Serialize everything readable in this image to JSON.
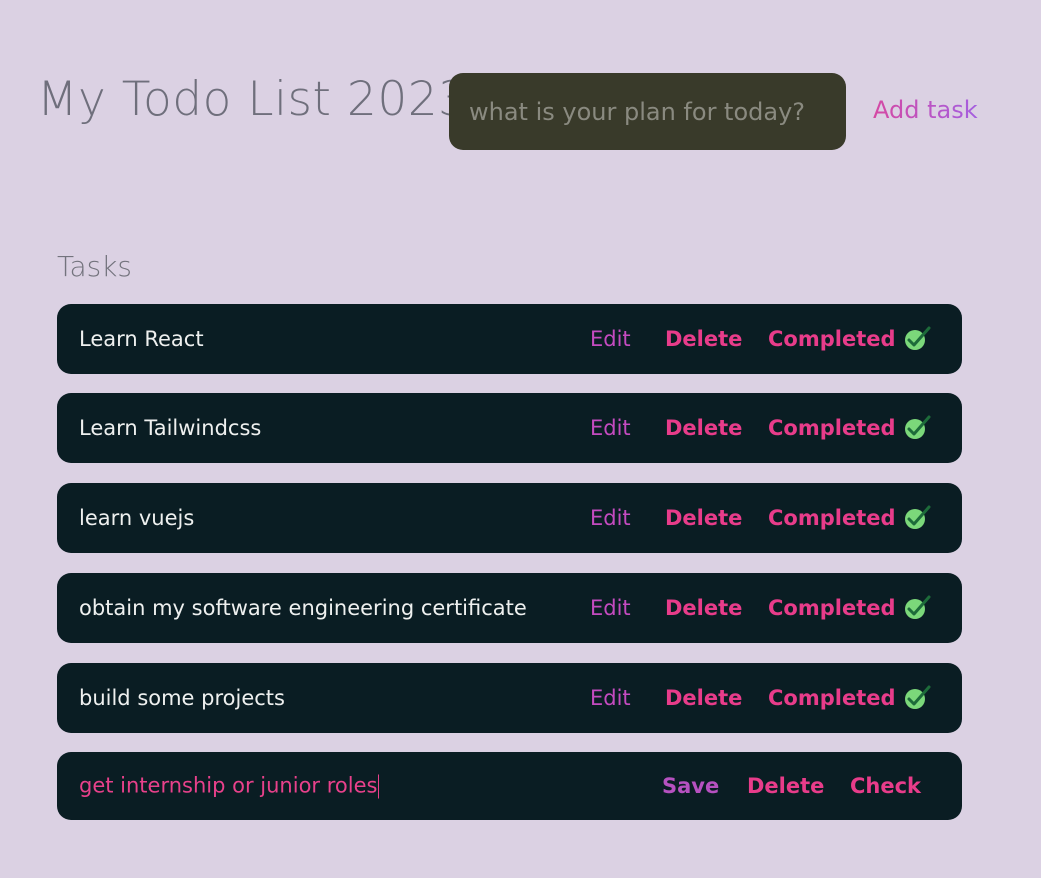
{
  "header": {
    "title": "My Todo List 2023",
    "input_placeholder": "what is your plan for today?",
    "input_value": "",
    "add_label": "Add task"
  },
  "section": {
    "title": "Tasks"
  },
  "actions": {
    "edit": "Edit",
    "delete": "Delete",
    "completed": "Completed",
    "save": "Save",
    "check": "Check"
  },
  "tasks": [
    {
      "text": "Learn React",
      "completed": true
    },
    {
      "text": "Learn Tailwindcss",
      "completed": true
    },
    {
      "text": "learn vuejs",
      "completed": true
    },
    {
      "text": "obtain my software engineering certificate",
      "completed": true
    },
    {
      "text": "build some projects",
      "completed": true
    }
  ],
  "editing_task": {
    "text": "get internship or junior roles"
  },
  "colors": {
    "background": "#dbd1e3",
    "row": "#0a1d23",
    "input": "#393a2a",
    "accent_pink": "#e83c8a",
    "accent_purple": "#c44bc0",
    "check_green": "#7bd87a"
  },
  "icons": {
    "completed": "checkmark-circle-icon"
  }
}
